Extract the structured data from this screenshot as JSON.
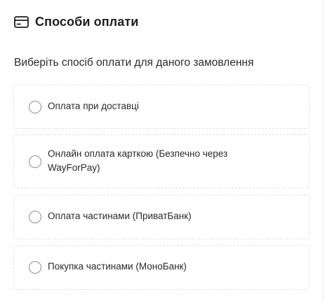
{
  "section": {
    "title": "Способи оплати",
    "icon": "credit-card-icon",
    "subtitle": "Виберіть спосіб оплати для даного замовлення"
  },
  "payment_options": [
    {
      "label": "Оплата при доставці",
      "selected": false
    },
    {
      "label": "Онлайн оплата карткою (Безпечно через WayForPay)",
      "selected": false
    },
    {
      "label": "Оплата частинами (ПриватБанк)",
      "selected": false
    },
    {
      "label": "Покупка частинами (МоноБанк)",
      "selected": false
    }
  ],
  "colors": {
    "text": "#1f1f1f",
    "border": "#e2e2e2",
    "radio_border": "#8f8f8f"
  }
}
